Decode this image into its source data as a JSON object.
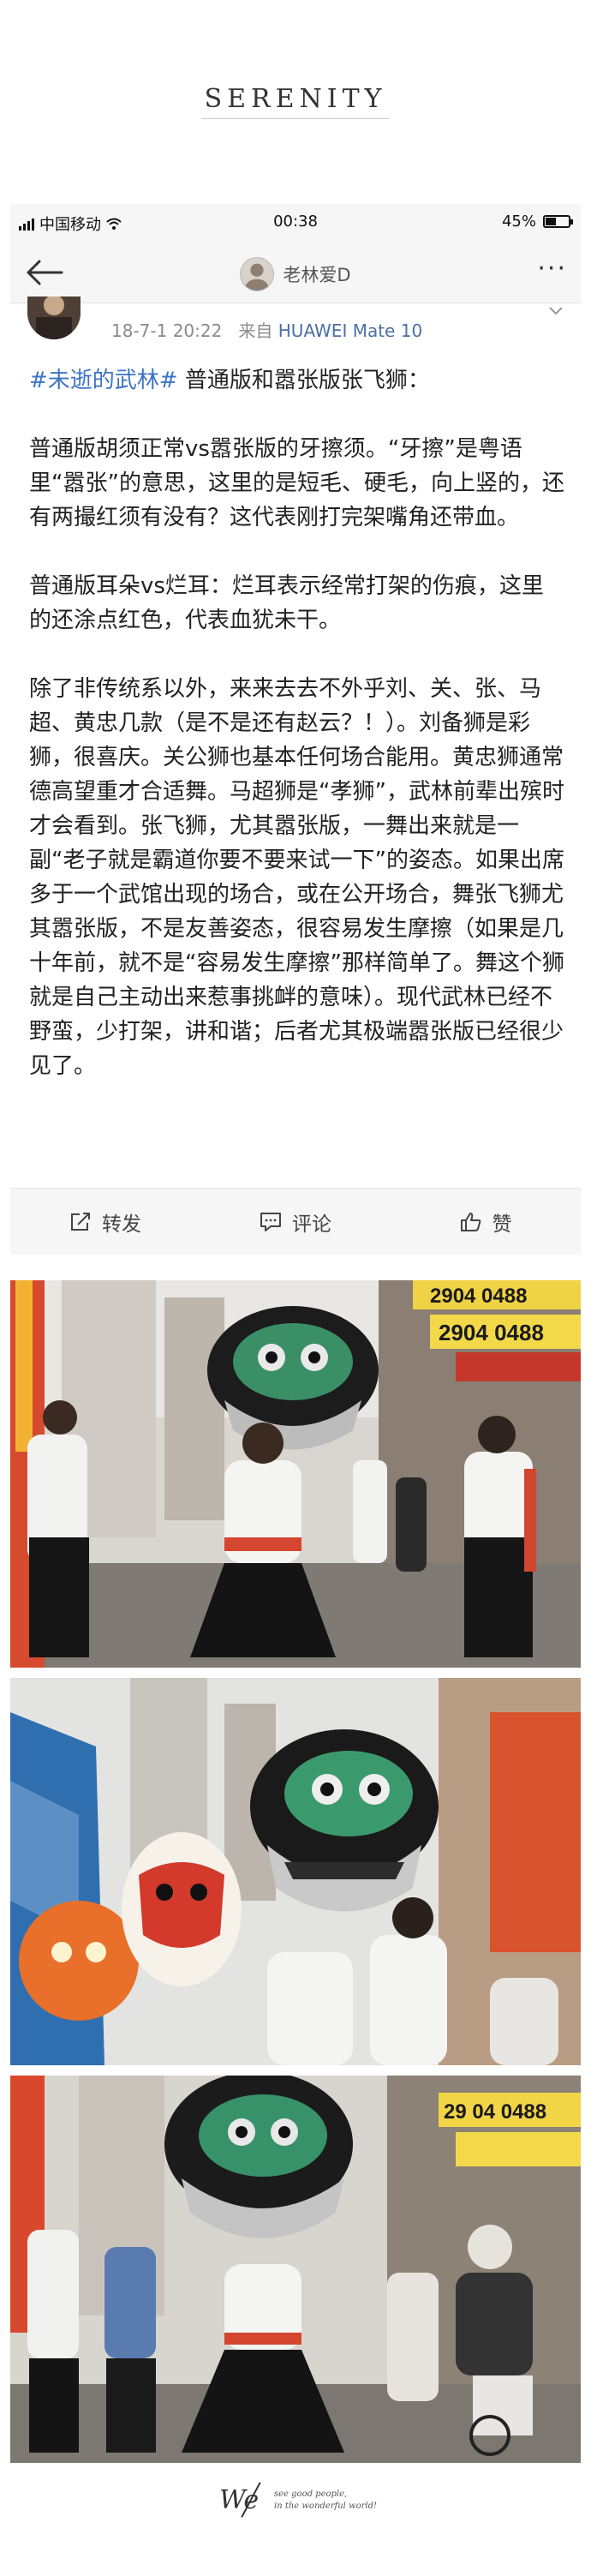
{
  "brand": {
    "title": "SERENITY"
  },
  "status_bar": {
    "carrier": "中国移动",
    "time": "00:38",
    "battery": "45%",
    "battery_level": 0.45
  },
  "nav": {
    "username": "老林爱D"
  },
  "post": {
    "date": "18-7-1 20:22",
    "source_prefix": "来自",
    "device": "HUAWEI Mate 10",
    "topic": "#未逝的武林#",
    "title_rest": " 普通版和嚣张版张飞狮：",
    "paragraphs": [
      "普通版胡须正常vs嚣张版的牙擦须。“牙擦”是粤语里“嚣张”的意思，这里的是短毛、硬毛，向上竖的，还有两撮红须有没有？这代表刚打完架嘴角还带血。",
      "普通版耳朵vs烂耳：烂耳表示经常打架的伤痕，这里的还涂点红色，代表血犹未干。",
      "除了非传统系以外，来来去去不外乎刘、关、张、马超、黄忠几款（是不是还有赵云？！）。刘备狮是彩狮，很喜庆。关公狮也基本任何场合能用。黄忠狮通常德高望重才合适舞。马超狮是“孝狮”，武林前辈出殡时才会看到。张飞狮，尤其嚣张版，一舞出来就是一副“老子就是霸道你要不要来试一下”的姿态。如果出席多于一个武馆出现的场合，或在公开场合，舞张飞狮尤其嚣张版，不是友善姿态，很容易发生摩擦（如果是几十年前，就不是“容易发生摩擦”那样简单了。舞这个狮就是自己主动出来惹事挑衅的意味）。现代武林已经不野蛮，少打架，讲和谐；后者尤其极端嚣张版已经很少见了。"
    ]
  },
  "actions": {
    "repost": "转发",
    "comment": "评论",
    "like": "赞"
  },
  "photo1_signs": {
    "sign_a": "2904 0488",
    "sign_b": "2904 0488"
  },
  "photo3_signs": {
    "sign_a": "29 04 0488"
  },
  "footer": {
    "logo": "We",
    "tagline_1": "see good people,",
    "tagline_2": "in the wonderful world!"
  }
}
